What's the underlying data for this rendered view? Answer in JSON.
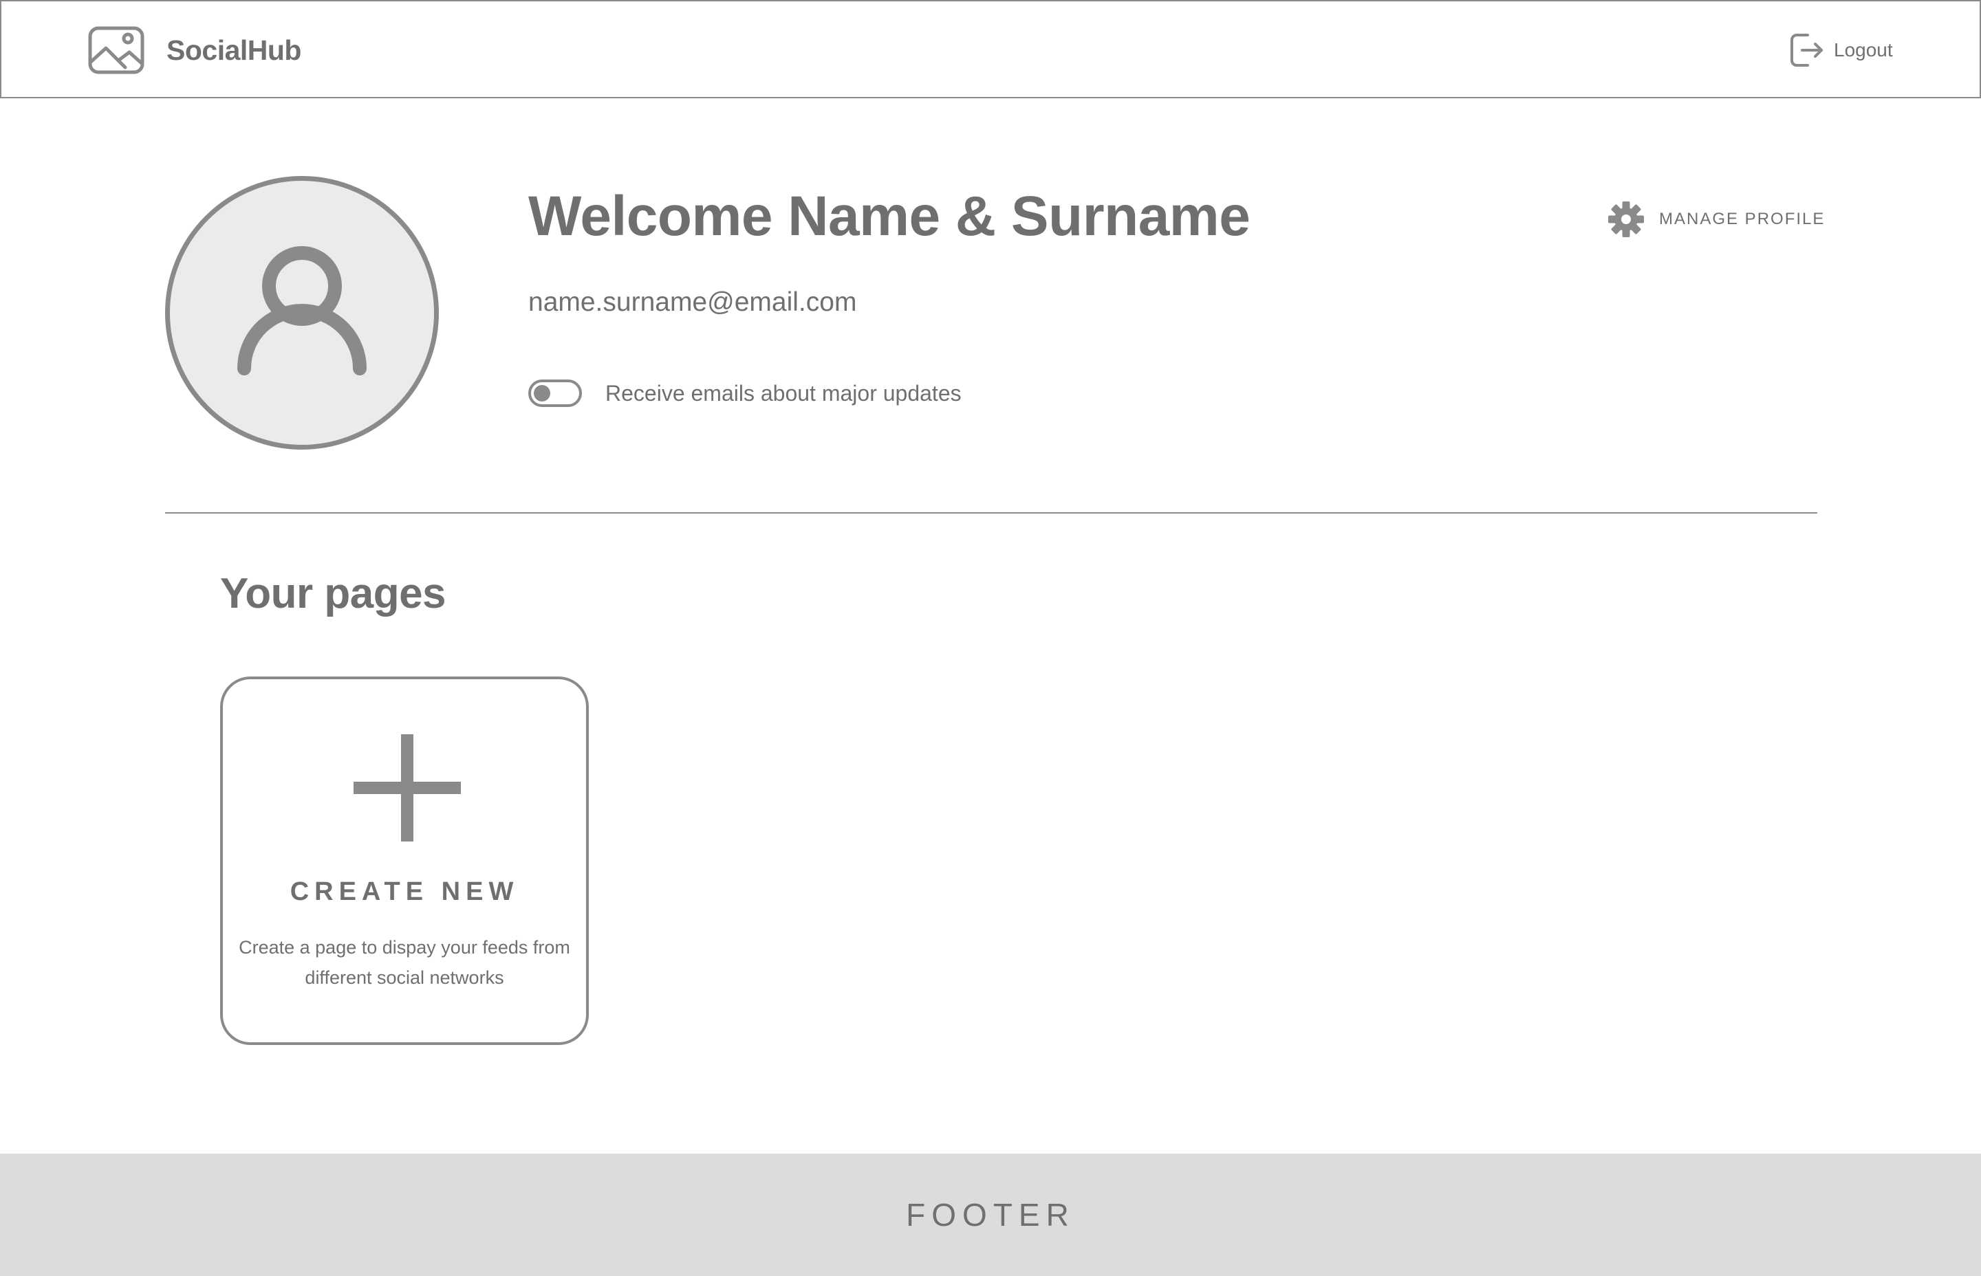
{
  "header": {
    "brand_name": "SocialHub",
    "brand_icon": "image-icon",
    "logout_label": "Logout",
    "logout_icon": "logout-icon"
  },
  "profile": {
    "avatar_icon": "user-icon",
    "welcome": "Welcome Name & Surname",
    "email": "name.surname@email.com",
    "email_toggle_label": "Receive emails about major updates",
    "email_toggle_on": false,
    "manage_label": "MANAGE PROFILE",
    "manage_icon": "gear-icon"
  },
  "pages": {
    "section_title": "Your pages",
    "create_card": {
      "icon": "plus-icon",
      "title": "CREATE NEW",
      "description": "Create a page to dispay your feeds from different social networks"
    }
  },
  "footer": {
    "label": "FOOTER"
  },
  "colors": {
    "text": "#6f6f6f",
    "stroke": "#8a8a8a",
    "avatar_fill": "#ebebeb",
    "footer_bg": "#dcdcdc",
    "background": "#ffffff"
  }
}
